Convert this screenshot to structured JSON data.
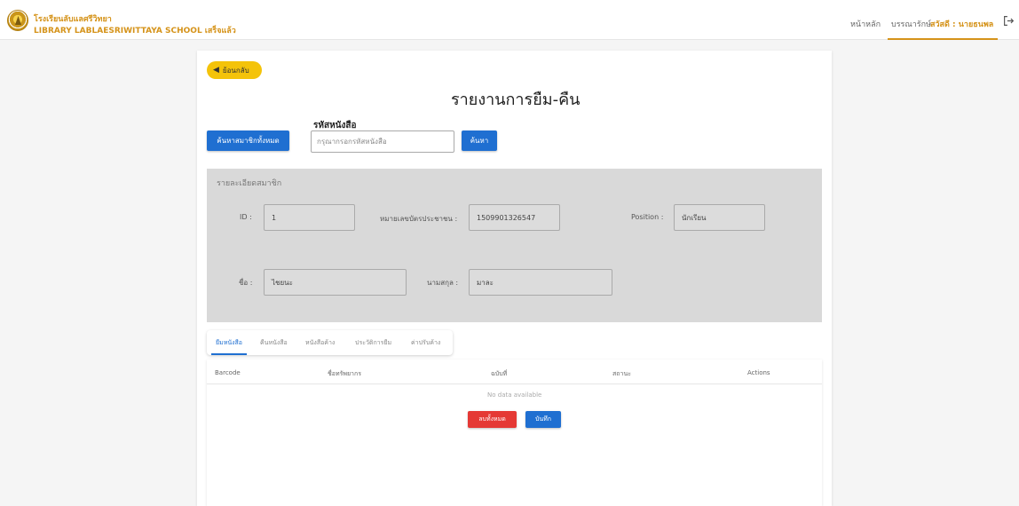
{
  "header": {
    "brand_line1": "โรงเรียนลับแลศรีวิทยา",
    "brand_line2": "LIBRARY LABLAESRIWITTAYA SCHOOL เสร็จแล้ว",
    "nav_home": "หน้าหลัก",
    "nav_librarian": "บรรณารักษ์",
    "greeting": "สวัสดี : นายธนพล",
    "accent_color": "#d5931a"
  },
  "back_label": "ย้อนกลับ",
  "page_title": "รายงานการยืม-คืน",
  "search": {
    "all_members_button": "ค้นหาสมาชิกทั้งหมด",
    "code_label": "รหัสหนังสือ",
    "code_placeholder": "กรุณากรอกรหัสหนังสือ",
    "search_button": "ค้นหา"
  },
  "member": {
    "section_title": "รายละเอียดสมาชิก",
    "id_label": "ID :",
    "id_value": "1",
    "national_id_label": "หมายเลขบัตรประชาชน :",
    "national_id_value": "1509901326547",
    "position_label": "Position :",
    "position_value": "นักเรียน",
    "first_name_label": "ชื่อ :",
    "first_name_value": "ไชยนะ",
    "last_name_label": "นามสกุล :",
    "last_name_value": "มาละ"
  },
  "tabs": [
    "ยืมหนังสือ",
    "คืนหนังสือ",
    "หนังสือค้าง",
    "ประวัติการยืม",
    "ค่าปรับค้าง"
  ],
  "table": {
    "headers": [
      "Barcode",
      "ชื่อทรัพยากร",
      "ฉบับที่",
      "สถานะ",
      "Actions"
    ],
    "empty_text": "No data available"
  },
  "actions": {
    "delete_all": "ลบทั้งหมด",
    "save": "บันทึก"
  },
  "icons": {
    "logo": "school-emblem-icon",
    "back": "arrow-left-icon",
    "logout": "logout-icon"
  }
}
